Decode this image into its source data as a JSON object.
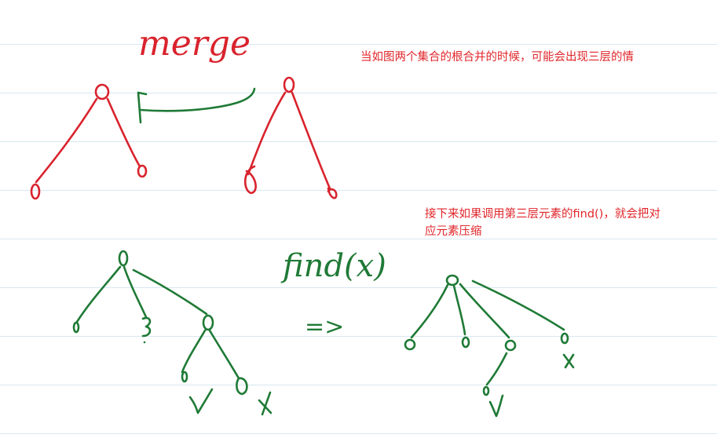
{
  "annotations": {
    "merge_label": "merge",
    "note_top": "当如图两个集合的根合并的时候，可能会出现三层的情",
    "note_bottom_line1": "接下来如果调用第三层元素的find()，就会把对",
    "note_bottom_line2": "应元素压缩",
    "find_label": "find(x)",
    "arrow_label": "=>",
    "x_mark_left": "x",
    "x_mark_right": "x"
  },
  "colors": {
    "red_ink": "#d9232d",
    "green_ink": "#1f7a36",
    "note_text": "#e0262b",
    "rule_lines": "#d7e8f2"
  }
}
